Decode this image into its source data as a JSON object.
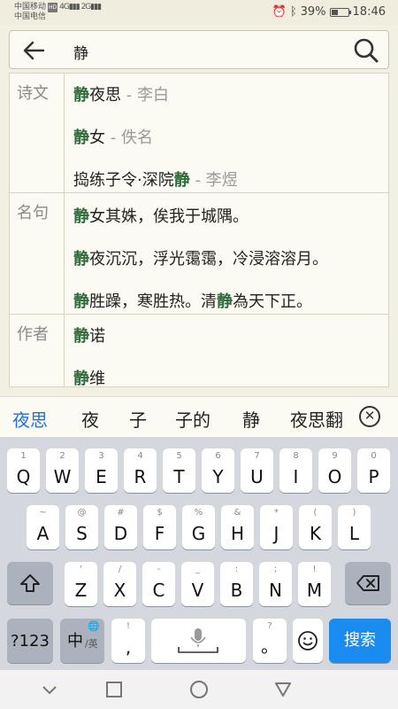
{
  "status_bar": {
    "carrier_1": "中国移动",
    "badge": "HD",
    "carrier_2": "中国电信",
    "battery_percent": "39%",
    "time": "18:46",
    "battery_level": 0.39
  },
  "search": {
    "query": "静"
  },
  "results": {
    "poems": {
      "label": "诗文",
      "items": [
        {
          "pre": "",
          "hl": "静",
          "post": "夜思",
          "author": " - 李白"
        },
        {
          "pre": "",
          "hl": "静",
          "post": "女",
          "author": " - 佚名"
        },
        {
          "pre": "捣练子令·深院",
          "hl": "静",
          "post": "",
          "author": " - 李煜"
        }
      ]
    },
    "quotes": {
      "label": "名句",
      "items": [
        {
          "hl": "静",
          "post": "女其姝，俟我于城隅。"
        },
        {
          "hl": "静",
          "post": "夜沉沉，浮光霭霭，冷浸溶溶月。"
        },
        {
          "hl": "静",
          "post": "胜躁，寒胜热。清",
          "hl2": "静",
          "post2": "為天下正。"
        }
      ]
    },
    "authors": {
      "label": "作者",
      "items": [
        {
          "hl": "静",
          "post": "诺"
        },
        {
          "hl": "静",
          "post": "维"
        }
      ]
    }
  },
  "candidates": [
    "夜思",
    "夜",
    "子",
    "子的",
    "静",
    "夜思翻"
  ],
  "keyboard": {
    "row1": [
      {
        "hint": "1",
        "main": "Q"
      },
      {
        "hint": "2",
        "main": "W"
      },
      {
        "hint": "3",
        "main": "E"
      },
      {
        "hint": "4",
        "main": "R"
      },
      {
        "hint": "5",
        "main": "T"
      },
      {
        "hint": "6",
        "main": "Y"
      },
      {
        "hint": "7",
        "main": "U"
      },
      {
        "hint": "8",
        "main": "I"
      },
      {
        "hint": "9",
        "main": "O"
      },
      {
        "hint": "0",
        "main": "P"
      }
    ],
    "row2": [
      {
        "hint": "~",
        "main": "A"
      },
      {
        "hint": "@",
        "main": "S"
      },
      {
        "hint": "#",
        "main": "D"
      },
      {
        "hint": "$",
        "main": "F"
      },
      {
        "hint": "%",
        "main": "G"
      },
      {
        "hint": "&",
        "main": "H"
      },
      {
        "hint": "*",
        "main": "J"
      },
      {
        "hint": "(",
        "main": "K"
      },
      {
        "hint": ")",
        "main": "L"
      }
    ],
    "row3": [
      {
        "hint": "'",
        "main": "Z"
      },
      {
        "hint": "/",
        "main": "X"
      },
      {
        "hint": "-",
        "main": "C"
      },
      {
        "hint": "_",
        "main": "V"
      },
      {
        "hint": ":",
        "main": "B"
      },
      {
        "hint": ";",
        "main": "N"
      },
      {
        "hint": "!",
        "main": "M"
      }
    ],
    "numbers_label": "?123",
    "lang_label": "中",
    "lang_sub": "/英",
    "comma_hint": "!",
    "comma_main": ",",
    "period_hint": "?",
    "period_main": "。",
    "search_label": "搜索"
  },
  "icons": {
    "back": "back-arrow-icon",
    "search": "search-icon",
    "close": "close-candidates-icon",
    "shift": "shift-icon",
    "backspace": "backspace-icon",
    "mic": "mic-icon",
    "emoji": "emoji-icon",
    "globe": "globe-icon"
  },
  "colors": {
    "highlight": "#2f6b3c",
    "accent": "#1a8cf0",
    "background": "#f2efe3"
  }
}
